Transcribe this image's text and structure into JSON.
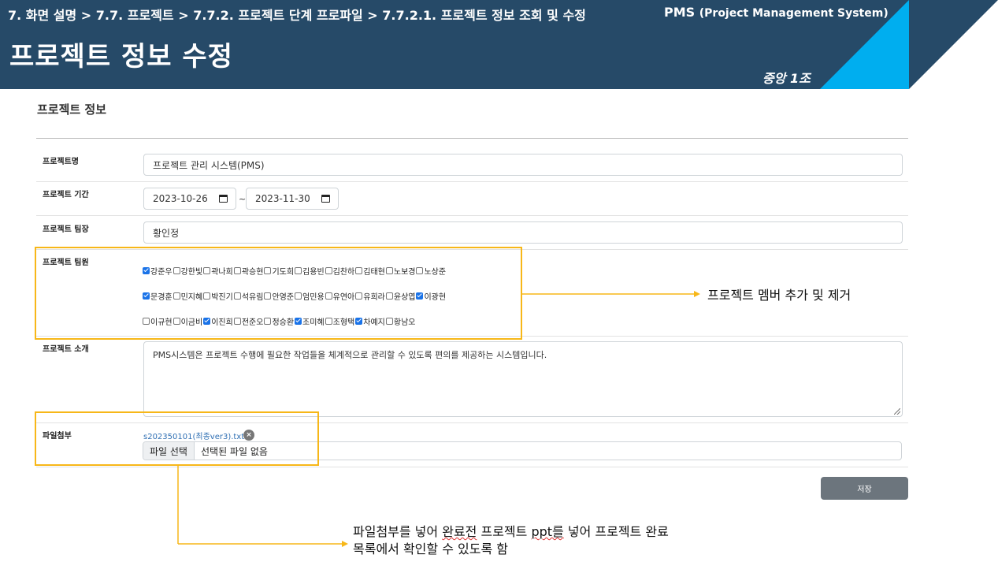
{
  "header": {
    "breadcrumb": "7. 화면 설명 > 7.7. 프로젝트 > 7.7.2. 프로젝트 단계 프로파일 > 7.7.2.1. 프로젝트 정보 조회 및 수정",
    "system_name_short": "PMS",
    "system_name_full": "(Project Management System)",
    "page_title": "프로젝트 정보 수정",
    "team_name": "중앙 1조",
    "colors": {
      "navy": "#264a68",
      "cyan": "#00aeef",
      "white": "#ffffff"
    }
  },
  "form": {
    "section_title": "프로젝트 정보",
    "name": {
      "label": "프로젝트명",
      "value": "프로젝트 관리 시스템(PMS)"
    },
    "period": {
      "label": "프로젝트 기간",
      "start": "2023-10-26",
      "separator": "~",
      "end": "2023-11-30"
    },
    "leader": {
      "label": "프로젝트 팀장",
      "value": "황인정"
    },
    "members": {
      "label": "프로젝트 팀원",
      "rows": [
        [
          {
            "name": "강준우",
            "checked": true
          },
          {
            "name": "강한빛",
            "checked": false
          },
          {
            "name": "곽나희",
            "checked": false
          },
          {
            "name": "곽승현",
            "checked": false
          },
          {
            "name": "기도희",
            "checked": false
          },
          {
            "name": "김용빈",
            "checked": false
          },
          {
            "name": "김찬하",
            "checked": false
          },
          {
            "name": "김태현",
            "checked": false
          },
          {
            "name": "노보경",
            "checked": false
          },
          {
            "name": "노상준",
            "checked": false
          }
        ],
        [
          {
            "name": "문경훈",
            "checked": true
          },
          {
            "name": "민지혜",
            "checked": false
          },
          {
            "name": "박진기",
            "checked": false
          },
          {
            "name": "석유림",
            "checked": false
          },
          {
            "name": "안영준",
            "checked": false
          },
          {
            "name": "엄민용",
            "checked": false
          },
          {
            "name": "유연아",
            "checked": false
          },
          {
            "name": "유희라",
            "checked": false
          },
          {
            "name": "윤상엽",
            "checked": false
          },
          {
            "name": "이광현",
            "checked": true
          }
        ],
        [
          {
            "name": "이규현",
            "checked": false
          },
          {
            "name": "이금비",
            "checked": false
          },
          {
            "name": "이진희",
            "checked": true
          },
          {
            "name": "전준오",
            "checked": false
          },
          {
            "name": "정승환",
            "checked": false
          },
          {
            "name": "조미혜",
            "checked": true
          },
          {
            "name": "조형택",
            "checked": false
          },
          {
            "name": "차예지",
            "checked": true
          },
          {
            "name": "황남오",
            "checked": false
          }
        ]
      ]
    },
    "intro": {
      "label": "프로젝트 소개",
      "value": "PMS시스템은 프로젝트 수행에 필요한 작업들을 체계적으로 관리할 수 있도록 편의를 제공하는 시스템입니다."
    },
    "attachment": {
      "label": "파일첨부",
      "file_name": "s202350101(최종ver3).txt",
      "choose_button": "파일 선택",
      "status": "선택된 파일 없음"
    },
    "save_button": "저장"
  },
  "annotations": {
    "members_note": "프로젝트 멤버 추가 및 제거",
    "file_note_line1_pre": "파일첨부를 넣어 ",
    "file_note_line1_squiggle": "완료전",
    "file_note_line1_mid": " 프로젝트 ",
    "file_note_line1_squiggle2": "ppt를",
    "file_note_line1_post": " 넣어 프로젝트 완료",
    "file_note_line2": "목록에서 확인할 수 있도록 함",
    "highlight_color": "#f7b718"
  }
}
